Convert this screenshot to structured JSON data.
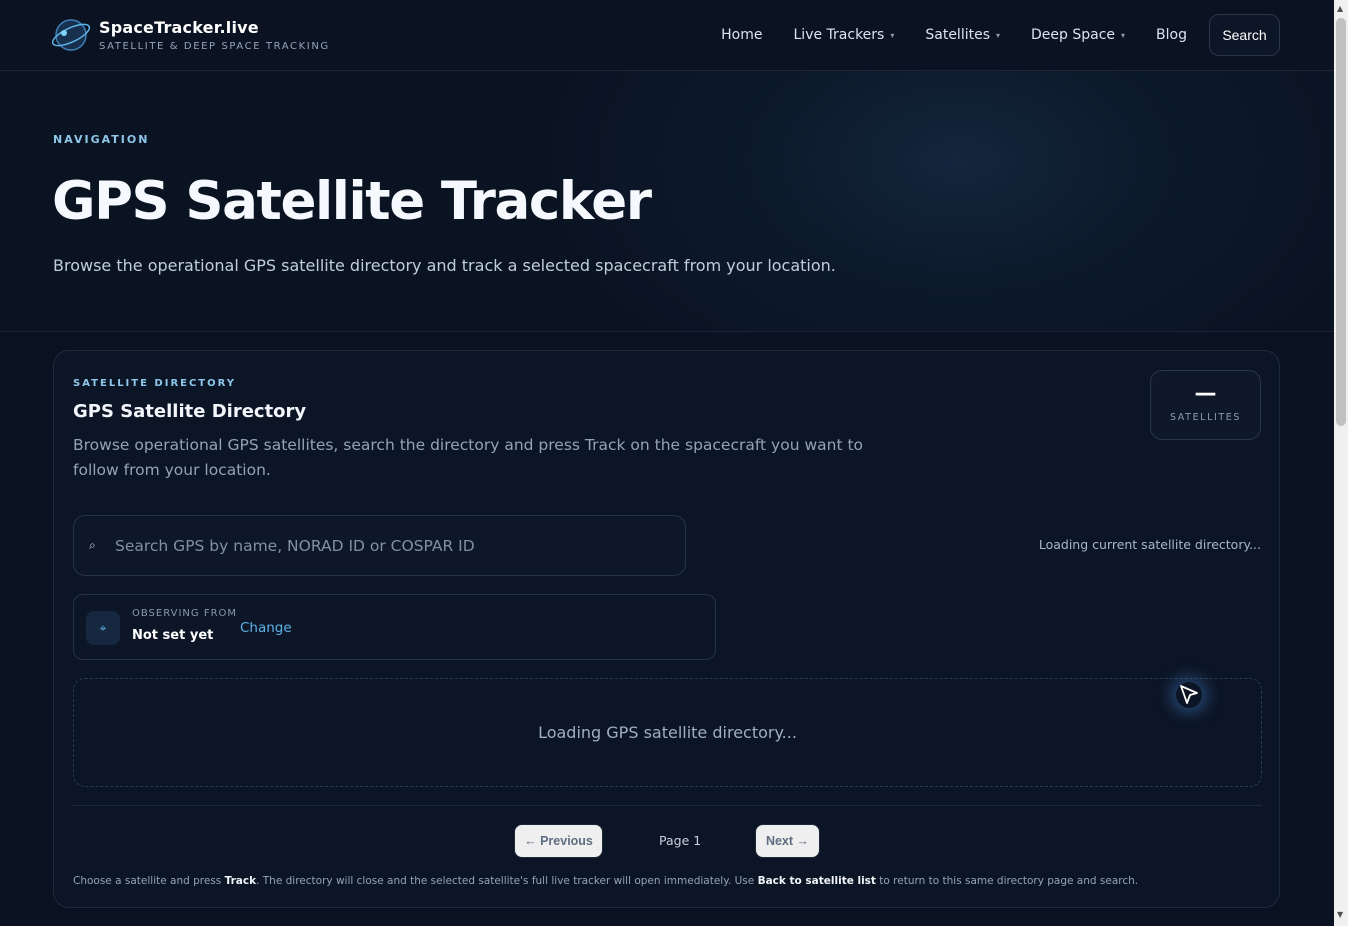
{
  "brand": {
    "name": "SpaceTracker.live",
    "tagline": "SATELLITE & DEEP SPACE TRACKING"
  },
  "nav": {
    "items": [
      {
        "label": "Home",
        "has_dropdown": false
      },
      {
        "label": "Live Trackers",
        "has_dropdown": true
      },
      {
        "label": "Satellites",
        "has_dropdown": true
      },
      {
        "label": "Deep Space",
        "has_dropdown": true
      },
      {
        "label": "Blog",
        "has_dropdown": false
      }
    ],
    "caret": "▾",
    "search_label": "Search"
  },
  "hero": {
    "eyebrow": "NAVIGATION",
    "title": "GPS Satellite Tracker",
    "subtitle": "Browse the operational GPS satellite directory and track a selected spacecraft from your location."
  },
  "directory": {
    "eyebrow": "SATELLITE DIRECTORY",
    "title": "GPS Satellite Directory",
    "description": "Browse operational GPS satellites, search the directory and press Track on the spacecraft you want to follow from your location.",
    "stat": {
      "value": "—",
      "label": "SATELLITES"
    },
    "search": {
      "icon": "⌕",
      "placeholder": "Search GPS by name, NORAD ID or COSPAR ID",
      "value": ""
    },
    "status": "Loading current satellite directory...",
    "observer": {
      "icon": "⌖",
      "label": "OBSERVING FROM",
      "value": "Not set yet",
      "change_label": "Change"
    },
    "loading_message": "Loading GPS satellite directory...",
    "pager": {
      "previous_label": "← Previous",
      "page_label": "Page 1",
      "next_label": "Next →"
    },
    "footnote": {
      "part1": "Choose a satellite and press ",
      "track_label": "Track",
      "part2": ". The directory will close and the selected satellite's full live tracker will open immediately. Use ",
      "back_label": "Back to satellite list",
      "part3": " to return to this same directory page and search."
    }
  },
  "colors": {
    "background": "#0a1120",
    "accent": "#5eb3e8",
    "eyebrow": "#8fc7ea"
  }
}
